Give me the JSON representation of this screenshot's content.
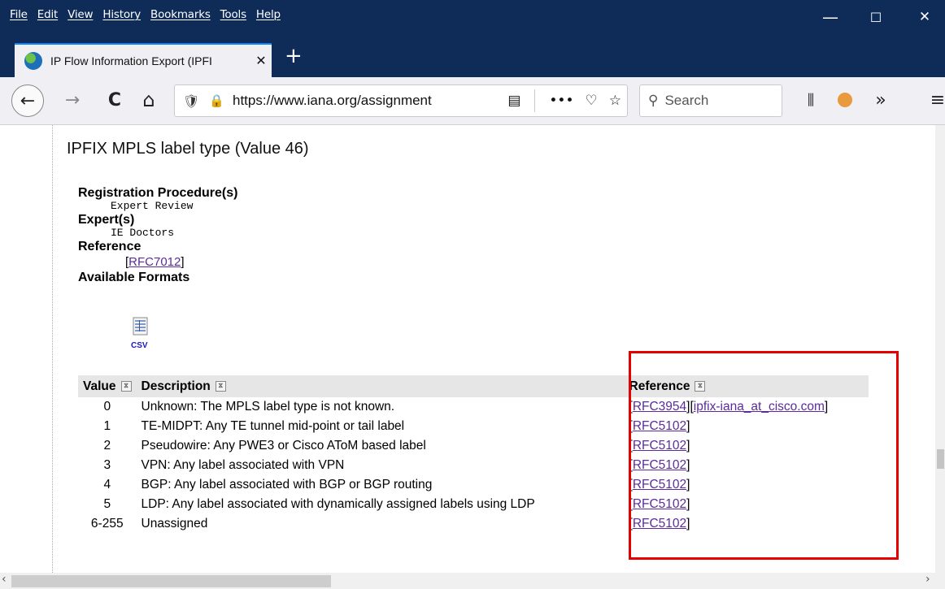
{
  "menu": [
    "File",
    "Edit",
    "View",
    "History",
    "Bookmarks",
    "Tools",
    "Help"
  ],
  "window_controls": {
    "minimize": "—",
    "maximize": "☐",
    "close": "✕"
  },
  "tab": {
    "title": "IP Flow Information Export (IPFI",
    "close": "✕"
  },
  "new_tab": "+",
  "nav": {
    "back": "←",
    "forward": "→",
    "reload": "C",
    "home": "⌂",
    "url": "https://www.iana.org/assignment",
    "more": "•••",
    "search_placeholder": "Search",
    "overflow": "»"
  },
  "page": {
    "heading": "IPFIX MPLS label type (Value 46)",
    "registration_label": "Registration Procedure(s)",
    "registration_value": "Expert Review",
    "experts_label": "Expert(s)",
    "experts_value": "IE Doctors",
    "reference_label": "Reference",
    "reference_link": "RFC7012",
    "formats_label": "Available Formats",
    "csv_label": "CSV"
  },
  "table": {
    "headers": [
      "Value",
      "Description",
      "Reference"
    ],
    "rows": [
      {
        "value": "0",
        "description": "Unknown: The MPLS label type is not known.",
        "refs": [
          "RFC3954",
          "ipfix-iana_at_cisco.com"
        ]
      },
      {
        "value": "1",
        "description": "TE-MIDPT: Any TE tunnel mid-point or tail label",
        "refs": [
          "RFC5102"
        ]
      },
      {
        "value": "2",
        "description": "Pseudowire: Any PWE3 or Cisco AToM based label",
        "refs": [
          "RFC5102"
        ]
      },
      {
        "value": "3",
        "description": "VPN: Any label associated with VPN",
        "refs": [
          "RFC5102"
        ]
      },
      {
        "value": "4",
        "description": "BGP: Any label associated with BGP or BGP routing",
        "refs": [
          "RFC5102"
        ]
      },
      {
        "value": "5",
        "description": "LDP: Any label associated with dynamically assigned labels using LDP",
        "refs": [
          "RFC5102"
        ]
      },
      {
        "value": "6-255",
        "description": "Unassigned",
        "refs": [
          "RFC5102"
        ]
      }
    ]
  },
  "colors": {
    "titlebar": "#0f2c59",
    "link": "#5b2b9e",
    "highlight": "#e60000",
    "header_bg": "#e6e6e6"
  }
}
